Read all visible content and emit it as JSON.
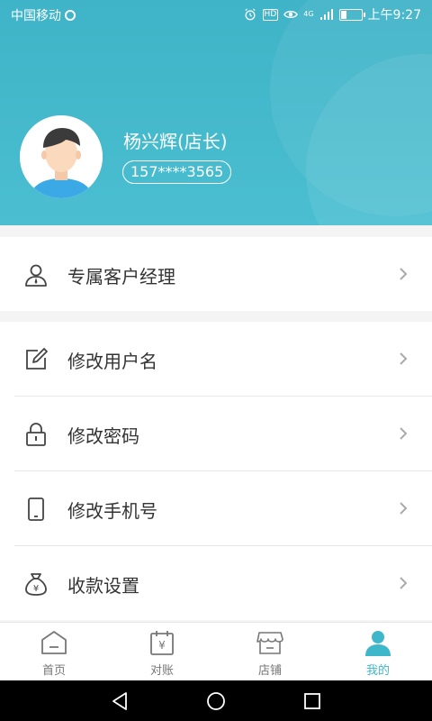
{
  "status": {
    "carrier": "中国移动",
    "hd": "HD",
    "signal": "4G",
    "time": "上午9:27"
  },
  "profile": {
    "name": "杨兴辉(店长)",
    "phone": "157****3565"
  },
  "menu": {
    "group1": [
      {
        "label": "专属客户经理",
        "icon": "user-manager-icon"
      }
    ],
    "group2": [
      {
        "label": "修改用户名",
        "icon": "edit-icon"
      },
      {
        "label": "修改密码",
        "icon": "lock-icon"
      },
      {
        "label": "修改手机号",
        "icon": "phone-icon"
      },
      {
        "label": "收款设置",
        "icon": "money-bag-icon"
      }
    ]
  },
  "tabs": [
    {
      "label": "首页",
      "icon": "home-icon"
    },
    {
      "label": "对账",
      "icon": "calendar-yen-icon"
    },
    {
      "label": "店铺",
      "icon": "store-icon"
    },
    {
      "label": "我的",
      "icon": "person-icon",
      "active": true
    }
  ],
  "colors": {
    "accent": "#3fb7cb",
    "header": "#44b8cb"
  }
}
